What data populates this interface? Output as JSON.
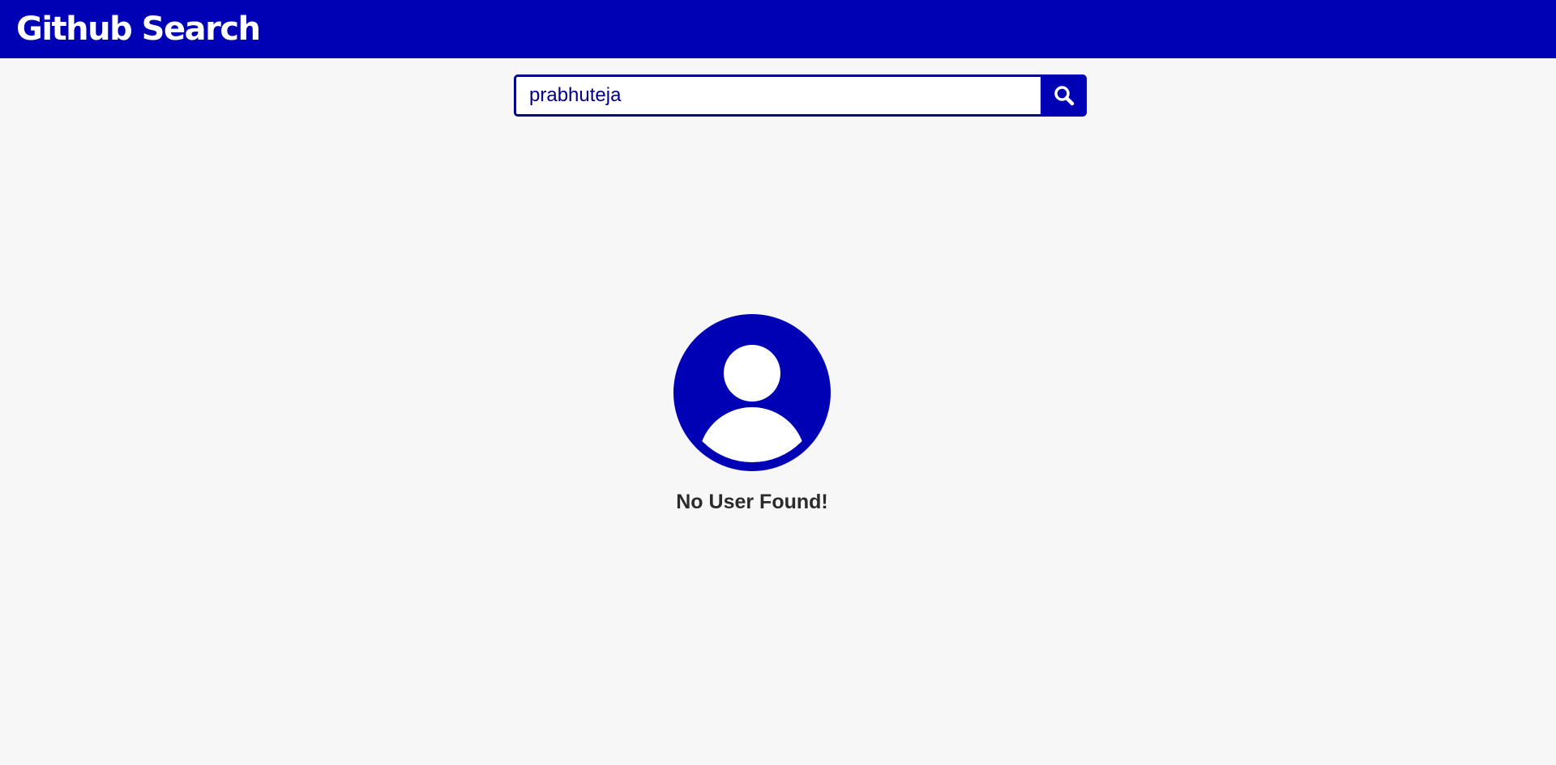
{
  "header": {
    "title": "Github Search"
  },
  "search": {
    "value": "prabhuteja",
    "button_icon": "search-icon"
  },
  "result": {
    "avatar_icon": "user-icon",
    "message": "No User Found!"
  },
  "colors": {
    "brand": "#0000b5",
    "input_border": "#00008b",
    "background": "#f7f7f7",
    "message_text": "#2b2b2b"
  }
}
